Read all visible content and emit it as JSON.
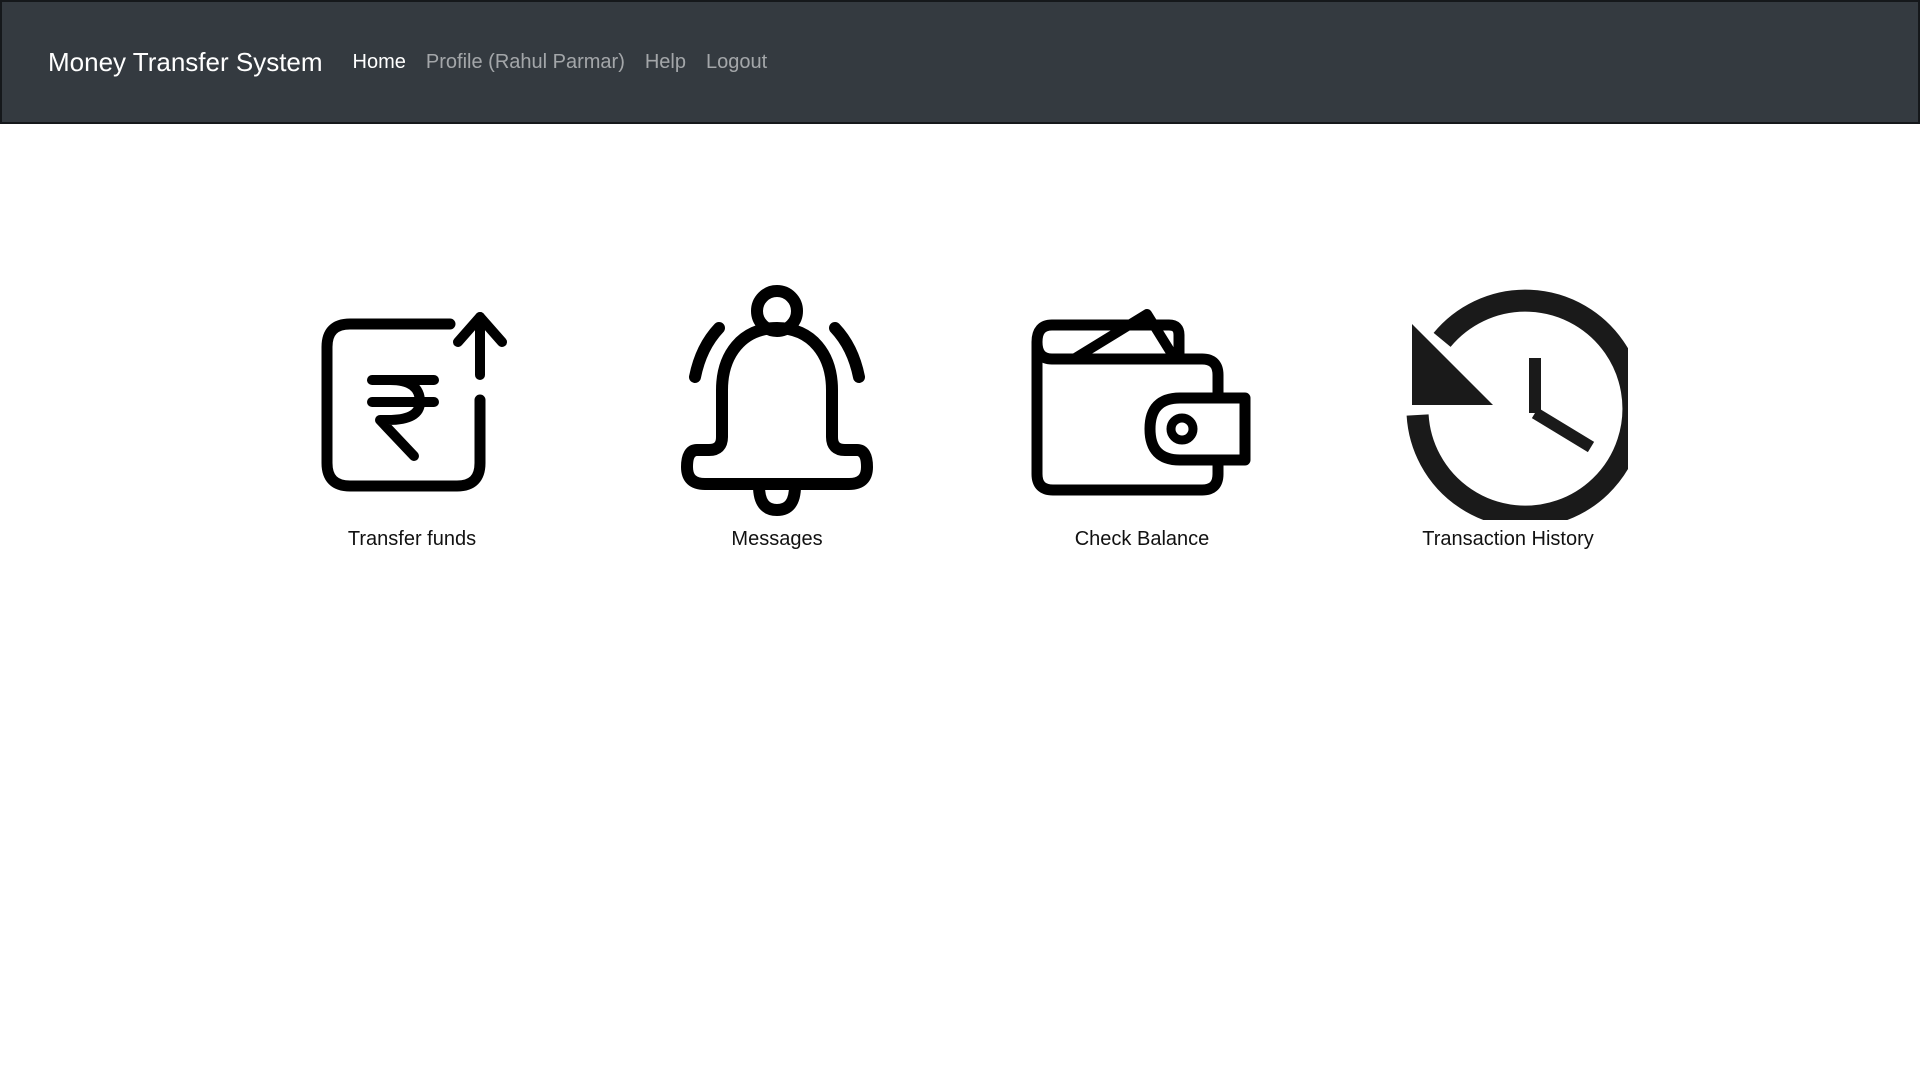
{
  "navbar": {
    "brand": "Money Transfer System",
    "links": [
      {
        "label": "Home",
        "active": true
      },
      {
        "label": "Profile (Rahul Parmar)",
        "active": false
      },
      {
        "label": "Help",
        "active": false
      },
      {
        "label": "Logout",
        "active": false
      }
    ],
    "background_color": "#343a40"
  },
  "tiles": [
    {
      "label": "Transfer funds",
      "icon": "rupee-transfer-icon"
    },
    {
      "label": "Messages",
      "icon": "bell-icon"
    },
    {
      "label": "Check Balance",
      "icon": "wallet-icon"
    },
    {
      "label": "Transaction History",
      "icon": "history-icon"
    }
  ]
}
